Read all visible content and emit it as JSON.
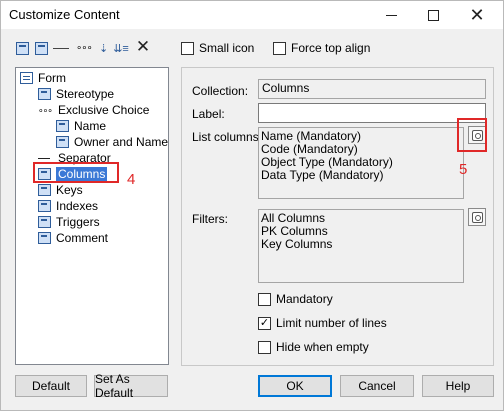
{
  "window": {
    "title": "Customize Content"
  },
  "toolbar": {
    "small_icon_label": "Small icon",
    "small_icon_checked": false,
    "force_top_align_label": "Force top align",
    "force_top_align_checked": false
  },
  "tree": {
    "items": [
      {
        "label": "Form",
        "icon": "form-icon"
      },
      {
        "label": "Stereotype",
        "icon": "element-icon"
      },
      {
        "label": "Exclusive Choice",
        "icon": "dots-icon"
      },
      {
        "label": "Name",
        "icon": "element-icon"
      },
      {
        "label": "Owner and Name",
        "icon": "element-icon"
      },
      {
        "label": "Separator",
        "icon": "separator-icon"
      },
      {
        "label": "Columns",
        "icon": "element-icon",
        "selected": true
      },
      {
        "label": "Keys",
        "icon": "element-icon"
      },
      {
        "label": "Indexes",
        "icon": "element-icon"
      },
      {
        "label": "Triggers",
        "icon": "element-icon"
      },
      {
        "label": "Comment",
        "icon": "element-icon"
      }
    ]
  },
  "annotations": {
    "four": "4",
    "five": "5",
    "color": "#e02828"
  },
  "details": {
    "collection_label": "Collection:",
    "collection_value": "Columns",
    "label_label": "Label:",
    "label_value": "",
    "list_columns_label": "List columns:",
    "list_columns": [
      "Name (Mandatory)",
      "Code (Mandatory)",
      "Object Type (Mandatory)",
      "Data Type (Mandatory)"
    ],
    "filters_label": "Filters:",
    "filters": [
      "All Columns",
      "PK Columns",
      "Key Columns"
    ],
    "mandatory_label": "Mandatory",
    "mandatory_checked": false,
    "limit_lines_label": "Limit number of lines",
    "limit_lines_checked": true,
    "hide_empty_label": "Hide when empty",
    "hide_empty_checked": false
  },
  "buttons": {
    "default": "Default",
    "set_as_default": "Set As Default",
    "ok": "OK",
    "cancel": "Cancel",
    "help": "Help"
  },
  "colors": {
    "selection": "#3a78d6",
    "accent": "#0078d7"
  }
}
